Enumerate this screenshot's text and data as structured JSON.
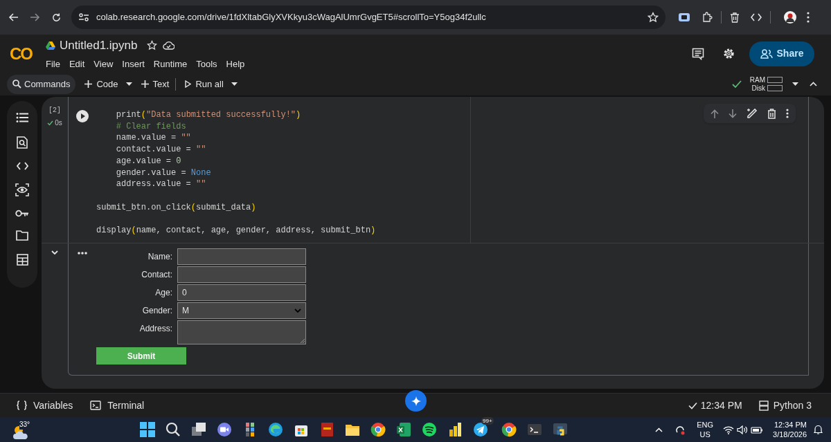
{
  "browser": {
    "url": "colab.research.google.com/drive/1fdXltabGlyXVKkyu3cWagAlUmrGvgET5#scrollTo=Y5og34f2ullc"
  },
  "app": {
    "logo": "CO",
    "title": "Untitled1.ipynb",
    "menu": [
      "File",
      "Edit",
      "View",
      "Insert",
      "Runtime",
      "Tools",
      "Help"
    ],
    "share": "Share"
  },
  "toolbar": {
    "commands": "Commands",
    "buttons": [
      {
        "label": "Code",
        "kind": "add",
        "caret": true
      },
      {
        "label": "Text",
        "kind": "add",
        "caret": false
      },
      {
        "label": "Run all",
        "kind": "run",
        "caret": true
      }
    ],
    "ram": "RAM",
    "disk": "Disk"
  },
  "code_cell": {
    "execution_count": "[2]",
    "duration": "0s",
    "lines": [
      {
        "segments": [
          {
            "text": "    print",
            "kind": "plain"
          },
          {
            "text": "(",
            "kind": "paren"
          },
          {
            "text": "\"Data submitted successfully!\"",
            "kind": "string"
          },
          {
            "text": ")",
            "kind": "paren"
          }
        ]
      },
      {
        "segments": [
          {
            "text": "    # Clear fields",
            "kind": "comment"
          }
        ]
      },
      {
        "segments": [
          {
            "text": "    name.value = ",
            "kind": "plain"
          },
          {
            "text": "\"\"",
            "kind": "string"
          }
        ]
      },
      {
        "segments": [
          {
            "text": "    contact.value = ",
            "kind": "plain"
          },
          {
            "text": "\"\"",
            "kind": "string"
          }
        ]
      },
      {
        "segments": [
          {
            "text": "    age.value = ",
            "kind": "plain"
          },
          {
            "text": "0",
            "kind": "number"
          }
        ]
      },
      {
        "segments": [
          {
            "text": "    gender.value = ",
            "kind": "plain"
          },
          {
            "text": "None",
            "kind": "keyword"
          }
        ]
      },
      {
        "segments": [
          {
            "text": "    address.value = ",
            "kind": "plain"
          },
          {
            "text": "\"\"",
            "kind": "string"
          }
        ]
      },
      {
        "gap_before": true,
        "segments": [
          {
            "text": "submit_btn.on_click",
            "kind": "plain"
          },
          {
            "text": "(",
            "kind": "paren"
          },
          {
            "text": "submit_data",
            "kind": "plain"
          },
          {
            "text": ")",
            "kind": "paren"
          }
        ]
      },
      {
        "gap_before": true,
        "segments": [
          {
            "text": "display",
            "kind": "plain"
          },
          {
            "text": "(",
            "kind": "paren"
          },
          {
            "text": "name, contact, age, gender, address, submit_btn",
            "kind": "plain"
          },
          {
            "text": ")",
            "kind": "paren"
          }
        ]
      }
    ]
  },
  "output_form": {
    "fields": [
      {
        "label": "Name:",
        "kind": "text"
      },
      {
        "label": "Contact:",
        "kind": "text"
      },
      {
        "label": "Age:",
        "kind": "text",
        "value": "0"
      },
      {
        "label": "Gender:",
        "kind": "select",
        "value": "M"
      },
      {
        "label": "Address:",
        "kind": "textarea"
      }
    ],
    "submit": "Submit"
  },
  "status_bar": {
    "items": [
      {
        "label": "Variables",
        "kind": "variables"
      },
      {
        "label": "Terminal",
        "kind": "terminal"
      }
    ],
    "time": "12:34 PM",
    "runtime": "Python 3"
  },
  "taskbar": {
    "temperature": "33°",
    "badge": "99+",
    "language": [
      "ENG",
      "US"
    ],
    "time": "12:34 PM",
    "date": "3/18/2026"
  }
}
